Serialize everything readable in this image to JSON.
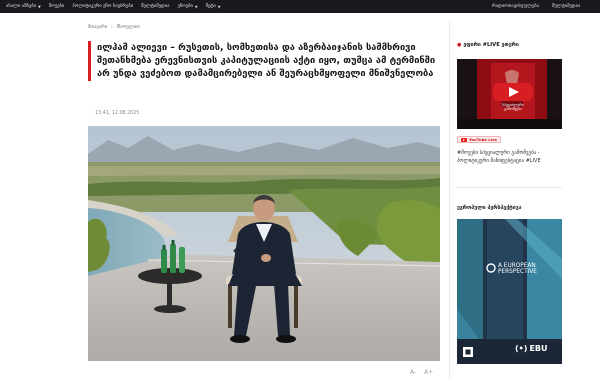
{
  "topnav": {
    "items": [
      {
        "label": "ახალი ამბები",
        "has_caret": true
      },
      {
        "label": "შოუები",
        "has_caret": false
      },
      {
        "label": "პოლიტიკური ეჩო საუბრები",
        "has_caret": false
      },
      {
        "label": "მულტიმედია",
        "has_caret": false
      },
      {
        "label": "ეჩოები",
        "has_caret": true
      },
      {
        "label": "მეტი",
        "has_caret": true
      }
    ],
    "right_items": [
      "რადიოთავისუფლება",
      "მულტიმედია"
    ]
  },
  "breadcrumb": {
    "home": "მთავარი",
    "section": "მსოფლიო"
  },
  "article": {
    "title": "ილჰამ ალიევი – რუსეთის, სომხეთისა და აზერბაიჯანის სამმხრივი შეთანხმება ერევნისთვის კაპიტულაციის აქტი იყო, თუმცა ამ ტერმინში არ უნდა ვეძებოთ დამამცირებელი ან შეურაცხმყოფელი მნიშვნელობა",
    "timestamp": "13:41, 12.08.2025"
  },
  "font_tools": {
    "decrease": "A-",
    "increase": "A+"
  },
  "sidebar": {
    "live_heading": "ეფირი #LIVE ეთერი",
    "live_thumb_title": "სპეციალური გამოშვება",
    "youtube_badge": "YouTube Live",
    "live_caption": "#შოუები სპეციალური გამოშვება - პოლიტიკური მანიფესტაცია #LIVE",
    "euro_heading": "ევროპული პერსპექტივა",
    "euro_logo_text": "A EUROPEAN PERSPECTIVE",
    "euro_ebu": "EBU"
  },
  "colors": {
    "accent": "#d71e22",
    "nav_bg": "#17191c"
  }
}
